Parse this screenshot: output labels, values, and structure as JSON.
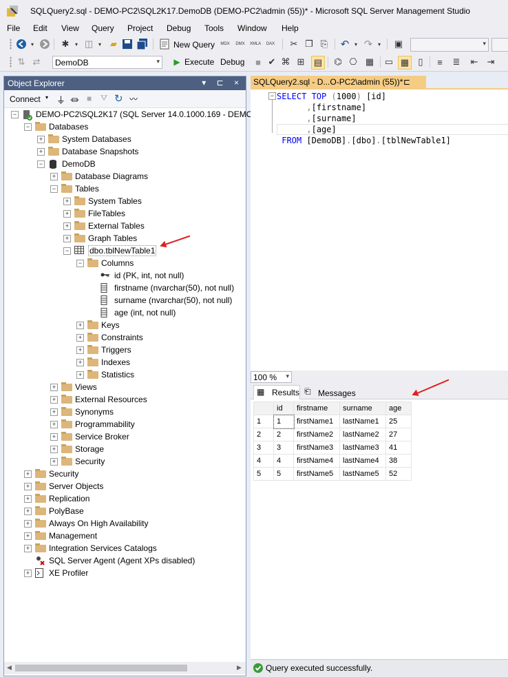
{
  "window": {
    "title": "SQLQuery2.sql - DEMO-PC2\\SQL2K17.DemoDB (DEMO-PC2\\admin (55))* - Microsoft SQL Server Management Studio"
  },
  "menu": [
    "File",
    "Edit",
    "View",
    "Query",
    "Project",
    "Debug",
    "Tools",
    "Window",
    "Help"
  ],
  "toolbar": {
    "new_query": "New Query",
    "database": "DemoDB",
    "execute": "Execute",
    "debug": "Debug",
    "icons": [
      "back-icon",
      "forward-icon",
      "new-project-icon",
      "add-item-icon",
      "open-file-icon",
      "save-icon",
      "save-all-icon",
      "new-query-icon",
      "mdx-icon",
      "dmx-icon",
      "xmla-icon",
      "dax-icon",
      "cut-icon",
      "copy-icon",
      "paste-icon",
      "undo-icon",
      "redo-icon",
      "activity-monitor-icon"
    ],
    "small_labels": [
      "MDX",
      "DMX",
      "XMLA",
      "DAX"
    ]
  },
  "object_explorer": {
    "title": "Object Explorer",
    "header_buttons": "▾ ⊏ ×",
    "connect": "Connect",
    "tree": [
      {
        "label": "DEMO-PC2\\SQL2K17 (SQL Server 14.0.1000.169 - DEMO-PC2\\admin)",
        "level": 0,
        "expanded": true,
        "icon": "server-icon"
      },
      {
        "label": "Databases",
        "level": 1,
        "expanded": true,
        "icon": "folder-icon"
      },
      {
        "label": "System Databases",
        "level": 2,
        "expanded": false,
        "icon": "folder-icon"
      },
      {
        "label": "Database Snapshots",
        "level": 2,
        "expanded": false,
        "icon": "folder-icon"
      },
      {
        "label": "DemoDB",
        "level": 2,
        "expanded": true,
        "icon": "database-icon"
      },
      {
        "label": "Database Diagrams",
        "level": 3,
        "expanded": false,
        "icon": "folder-icon"
      },
      {
        "label": "Tables",
        "level": 3,
        "expanded": true,
        "icon": "folder-icon"
      },
      {
        "label": "System Tables",
        "level": 4,
        "expanded": false,
        "icon": "folder-icon"
      },
      {
        "label": "FileTables",
        "level": 4,
        "expanded": false,
        "icon": "folder-icon"
      },
      {
        "label": "External Tables",
        "level": 4,
        "expanded": false,
        "icon": "folder-icon"
      },
      {
        "label": "Graph Tables",
        "level": 4,
        "expanded": false,
        "icon": "folder-icon"
      },
      {
        "label": "dbo.tblNewTable1",
        "level": 4,
        "expanded": true,
        "icon": "table-icon"
      },
      {
        "label": "Columns",
        "level": 5,
        "expanded": true,
        "icon": "folder-icon"
      },
      {
        "label": "id (PK, int, not null)",
        "level": 6,
        "expanded": null,
        "icon": "key-icon"
      },
      {
        "label": "firstname (nvarchar(50), not null)",
        "level": 6,
        "expanded": null,
        "icon": "column-icon"
      },
      {
        "label": "surname (nvarchar(50), not null)",
        "level": 6,
        "expanded": null,
        "icon": "column-icon"
      },
      {
        "label": "age (int, not null)",
        "level": 6,
        "expanded": null,
        "icon": "column-icon"
      },
      {
        "label": "Keys",
        "level": 5,
        "expanded": false,
        "icon": "folder-icon"
      },
      {
        "label": "Constraints",
        "level": 5,
        "expanded": false,
        "icon": "folder-icon"
      },
      {
        "label": "Triggers",
        "level": 5,
        "expanded": false,
        "icon": "folder-icon"
      },
      {
        "label": "Indexes",
        "level": 5,
        "expanded": false,
        "icon": "folder-icon"
      },
      {
        "label": "Statistics",
        "level": 5,
        "expanded": false,
        "icon": "folder-icon"
      },
      {
        "label": "Views",
        "level": 3,
        "expanded": false,
        "icon": "folder-icon"
      },
      {
        "label": "External Resources",
        "level": 3,
        "expanded": false,
        "icon": "folder-icon"
      },
      {
        "label": "Synonyms",
        "level": 3,
        "expanded": false,
        "icon": "folder-icon"
      },
      {
        "label": "Programmability",
        "level": 3,
        "expanded": false,
        "icon": "folder-icon"
      },
      {
        "label": "Service Broker",
        "level": 3,
        "expanded": false,
        "icon": "folder-icon"
      },
      {
        "label": "Storage",
        "level": 3,
        "expanded": false,
        "icon": "folder-icon"
      },
      {
        "label": "Security",
        "level": 3,
        "expanded": false,
        "icon": "folder-icon"
      },
      {
        "label": "Security",
        "level": 1,
        "expanded": false,
        "icon": "folder-icon"
      },
      {
        "label": "Server Objects",
        "level": 1,
        "expanded": false,
        "icon": "folder-icon"
      },
      {
        "label": "Replication",
        "level": 1,
        "expanded": false,
        "icon": "folder-icon"
      },
      {
        "label": "PolyBase",
        "level": 1,
        "expanded": false,
        "icon": "folder-icon"
      },
      {
        "label": "Always On High Availability",
        "level": 1,
        "expanded": false,
        "icon": "folder-icon"
      },
      {
        "label": "Management",
        "level": 1,
        "expanded": false,
        "icon": "folder-icon"
      },
      {
        "label": "Integration Services Catalogs",
        "level": 1,
        "expanded": false,
        "icon": "folder-icon"
      },
      {
        "label": "SQL Server Agent (Agent XPs disabled)",
        "level": 1,
        "expanded": null,
        "icon": "agent-icon"
      },
      {
        "label": "XE Profiler",
        "level": 1,
        "expanded": false,
        "icon": "profiler-icon"
      }
    ]
  },
  "editor": {
    "tab_title": "SQLQuery2.sql - D...O-PC2\\admin (55))*",
    "tab_buttons": "⊏ ×",
    "lines": [
      [
        [
          "kw",
          "SELECT "
        ],
        [
          "kw",
          "TOP "
        ],
        [
          "gr",
          "("
        ],
        [
          "t",
          "1000"
        ],
        [
          "gr",
          ") "
        ],
        [
          "t",
          "[id]"
        ]
      ],
      [
        [
          "t",
          "      "
        ],
        [
          "gr",
          ","
        ],
        [
          "t",
          "[firstname]"
        ]
      ],
      [
        [
          "t",
          "      "
        ],
        [
          "gr",
          ","
        ],
        [
          "t",
          "[surname]"
        ]
      ],
      [
        [
          "t",
          "      "
        ],
        [
          "gr",
          ","
        ],
        [
          "t",
          "[age]"
        ]
      ],
      [
        [
          "t",
          " "
        ],
        [
          "kw",
          "FROM "
        ],
        [
          "t",
          "[DemoDB]"
        ],
        [
          "gr",
          "."
        ],
        [
          "t",
          "[dbo]"
        ],
        [
          "gr",
          "."
        ],
        [
          "t",
          "[tblNewTable1]"
        ]
      ]
    ],
    "zoom": "100 %"
  },
  "results": {
    "tabs": [
      "Results",
      "Messages"
    ],
    "columns": [
      "id",
      "firstname",
      "surname",
      "age"
    ],
    "rows": [
      [
        "1",
        "1",
        "firstName1",
        "lastName1",
        "25"
      ],
      [
        "2",
        "2",
        "firstName2",
        "lastName2",
        "27"
      ],
      [
        "3",
        "3",
        "firstName3",
        "lastName3",
        "41"
      ],
      [
        "4",
        "4",
        "firstName4",
        "lastName4",
        "38"
      ],
      [
        "5",
        "5",
        "firstName5",
        "lastName5",
        "52"
      ]
    ]
  },
  "status": {
    "text": "Query executed successfully."
  },
  "colors": {
    "accent": "#f5cc84",
    "explorer_header": "#4d6082",
    "keyword": "#0000ff",
    "annotation_arrow": "#e02020"
  }
}
